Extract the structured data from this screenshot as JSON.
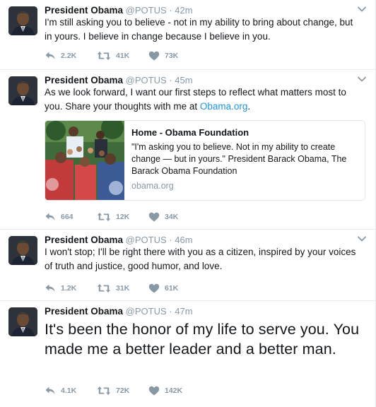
{
  "tweets": [
    {
      "name": "President Obama",
      "handle": "@POTUS",
      "separator": "·",
      "time": "42m",
      "text": "I'm still asking you to believe - not in my ability to bring about change, but in yours. I believe in change because I believe in you.",
      "replies": "2.2K",
      "retweets": "41K",
      "likes": "73K"
    },
    {
      "name": "President Obama",
      "handle": "@POTUS",
      "separator": "·",
      "time": "45m",
      "text_before": "As we look forward, I want our first steps to reflect what matters most to you. Share your thoughts with me at ",
      "text_link": "Obama.org",
      "text_after": ".",
      "card": {
        "title": "Home - Obama Foundation",
        "description": "\"I'm asking you to believe. Not in my ability to create change — but in yours.\" President Barack Obama, The Barack Obama Foundation",
        "domain": "obama.org"
      },
      "replies": "664",
      "retweets": "12K",
      "likes": "34K"
    },
    {
      "name": "President Obama",
      "handle": "@POTUS",
      "separator": "·",
      "time": "46m",
      "text": "I won't stop; I'll be right there with you as a citizen, inspired by your voices of truth and justice, good humor, and love.",
      "replies": "1.2K",
      "retweets": "31K",
      "likes": "61K"
    },
    {
      "name": "President Obama",
      "handle": "@POTUS",
      "separator": "·",
      "time": "47m",
      "text": "It's been the honor of my life to serve you. You made me a better leader and a better man.",
      "replies": "4.1K",
      "retweets": "72K",
      "likes": "142K"
    }
  ],
  "icons": {
    "reply": "reply-icon",
    "retweet": "retweet-icon",
    "like": "heart-icon",
    "caret": "chevron-down-icon"
  },
  "colors": {
    "link": "#1b95e0",
    "muted": "#8899a6",
    "text": "#14171a",
    "divider": "#e6ecf0"
  }
}
